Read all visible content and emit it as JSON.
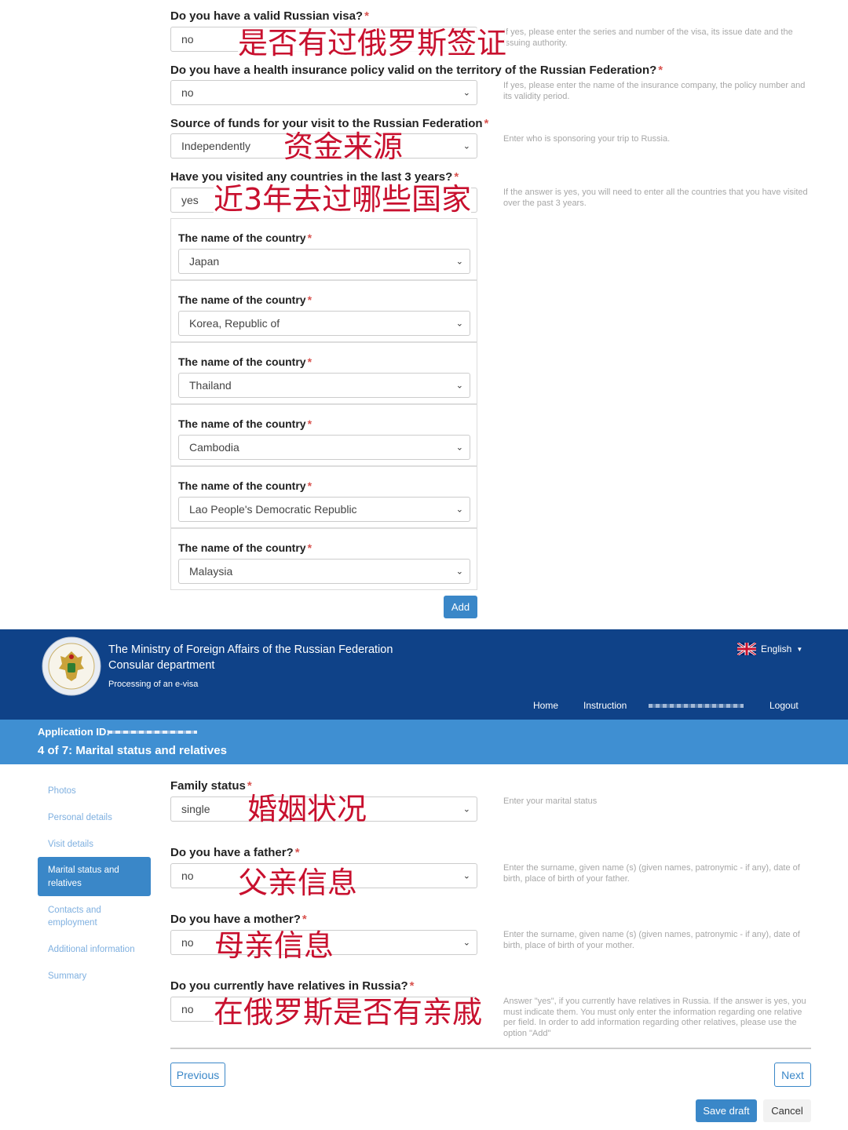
{
  "top_form": {
    "visa": {
      "label": "Do you have a valid Russian visa?",
      "value": "no",
      "hint": "If yes, please enter the series and number of the visa, its issue date and the issuing authority.",
      "annotation": "是否有过俄罗斯签证"
    },
    "insurance": {
      "label": "Do you have a health insurance policy valid on the territory of the Russian Federation?",
      "value": "no",
      "hint": "If yes, please enter the name of the insurance company, the policy number and its validity period."
    },
    "funds": {
      "label": "Source of funds for your visit to the Russian Federation",
      "value": "Independently",
      "hint": "Enter who is sponsoring your trip to Russia.",
      "annotation": "资金来源"
    },
    "visited": {
      "label": "Have you visited any countries in the last 3 years?",
      "value": "yes",
      "hint": "If the answer is yes, you will need to enter all the countries that you have visited over the past 3 years.",
      "annotation": "近3年去过哪些国家"
    },
    "country_label": "The name of the country",
    "countries": [
      "Japan",
      "Korea, Republic of",
      "Thailand",
      "Cambodia",
      "Lao People's Democratic Republic",
      "Malaysia"
    ],
    "add_button": "Add"
  },
  "header": {
    "ministry": "The Ministry of Foreign Affairs of the Russian Federation",
    "department": "Consular department",
    "subtitle": "Processing of an e-visa",
    "language": "English",
    "nav": {
      "home": "Home",
      "instruction": "Instruction",
      "logout": "Logout"
    }
  },
  "application": {
    "id_label": "Application ID:",
    "step": "4 of 7: Marital status and relatives"
  },
  "sidebar": {
    "items": [
      "Photos",
      "Personal details",
      "Visit details",
      "Marital status and relatives",
      "Contacts and employment",
      "Additional information",
      "Summary"
    ]
  },
  "bottom_form": {
    "family": {
      "label": "Family status",
      "value": "single",
      "hint": "Enter your marital status",
      "annotation": "婚姻状况"
    },
    "father": {
      "label": "Do you have a father?",
      "value": "no",
      "hint": "Enter the surname, given name (s) (given names, patronymic - if any), date of birth, place of birth of your father.",
      "annotation": "父亲信息"
    },
    "mother": {
      "label": "Do you have a mother?",
      "value": "no",
      "hint": "Enter the surname, given name (s) (given names, patronymic - if any), date of birth, place of birth of your mother.",
      "annotation": "母亲信息"
    },
    "relatives": {
      "label": "Do you currently have relatives in Russia?",
      "value": "no",
      "hint": "Answer \"yes\", if you currently have relatives in Russia. If the answer is yes, you must indicate them. You must only enter the information regarding one relative per field. In order to add information regarding other relatives, please use the option \"Add\"",
      "annotation": "在俄罗斯是否有亲戚"
    }
  },
  "buttons": {
    "previous": "Previous",
    "next": "Next",
    "save_draft": "Save draft",
    "cancel": "Cancel"
  },
  "colors": {
    "header_bg": "#0f4288",
    "subheader_bg": "#3f8fd2",
    "accent": "#3a87c8",
    "annotation": "#c8102e",
    "required": "#d9534f"
  }
}
